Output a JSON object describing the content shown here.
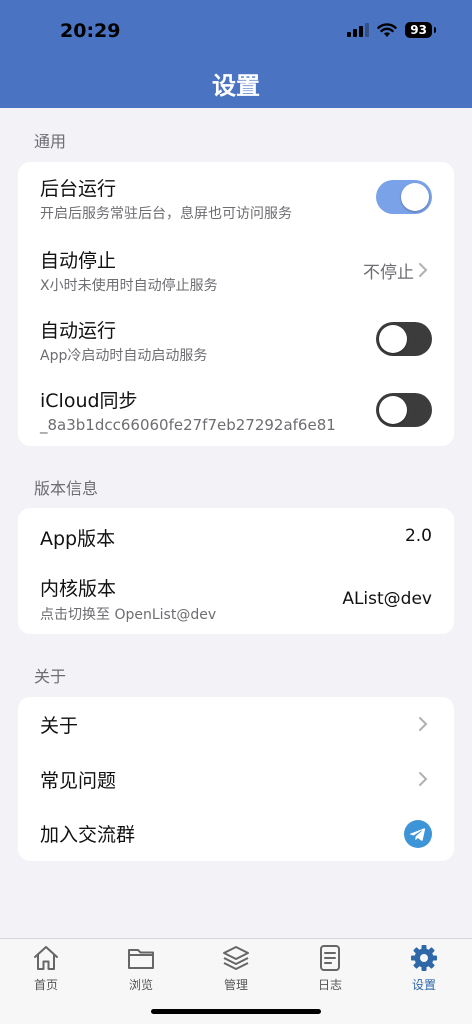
{
  "status": {
    "time": "20:29",
    "battery": "93"
  },
  "header": {
    "title": "设置"
  },
  "general": {
    "label": "通用",
    "rows": [
      {
        "title": "后台运行",
        "subtitle": "开启后服务常驻后台，息屏也可访问服务",
        "toggle": "on"
      },
      {
        "title": "自动停止",
        "subtitle": "X小时未使用时自动停止服务",
        "value": "不停止"
      },
      {
        "title": "自动运行",
        "subtitle": "App冷启动时自动启动服务",
        "toggle": "off"
      },
      {
        "title": "iCloud同步",
        "subtitle": "_8a3b1dcc66060fe27f7eb27292af6e81",
        "toggle": "off"
      }
    ]
  },
  "version": {
    "label": "版本信息",
    "rows": [
      {
        "title": "App版本",
        "value": "2.0"
      },
      {
        "title": "内核版本",
        "subtitle": "点击切换至 OpenList@dev",
        "value": "AList@dev"
      }
    ]
  },
  "about": {
    "label": "关于",
    "rows": [
      {
        "title": "关于"
      },
      {
        "title": "常见问题"
      },
      {
        "title": "加入交流群"
      }
    ]
  },
  "tabs": [
    {
      "label": "首页",
      "icon": "home-icon"
    },
    {
      "label": "浏览",
      "icon": "folder-icon"
    },
    {
      "label": "管理",
      "icon": "layers-icon"
    },
    {
      "label": "日志",
      "icon": "document-icon"
    },
    {
      "label": "设置",
      "icon": "gear-icon",
      "active": true
    }
  ],
  "colors": {
    "header": "#4a74c1",
    "accent": "#2f68a8",
    "toggle_on": "#7aa2e8",
    "toggle_off": "#3c3c3c"
  }
}
